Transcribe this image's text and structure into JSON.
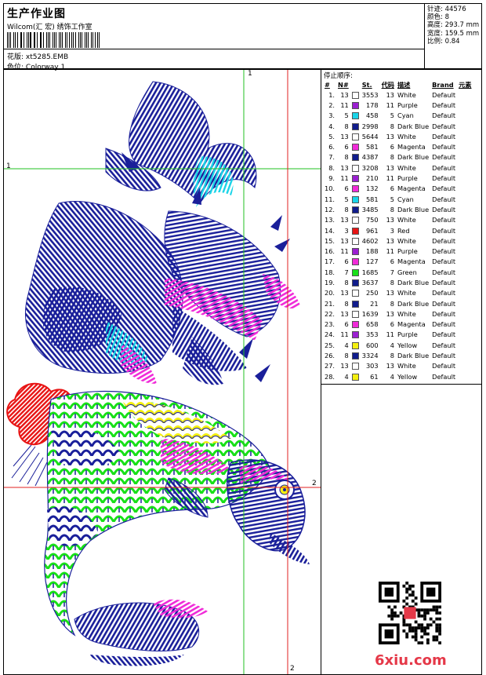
{
  "header": {
    "title": "生产作业图",
    "subtitle": "Wilcom(汇 宏) 绣饰工作室",
    "design_label": "花版:",
    "design_value": "xt5285.EMB",
    "colorway_label": "色位:",
    "colorway_value": "Colorway 1"
  },
  "stats": [
    {
      "label": "针迹:",
      "value": "44576"
    },
    {
      "label": "颜色:",
      "value": "8"
    },
    {
      "label": "高度:",
      "value": "293.7 mm"
    },
    {
      "label": "宽度:",
      "value": "159.5 mm"
    },
    {
      "label": "比例:",
      "value": "0.84"
    }
  ],
  "stop_sequence": {
    "title": "停止顺序:",
    "headers": [
      "#",
      "N#",
      "St.",
      "代码",
      "描述",
      "Brand",
      "元素"
    ],
    "rows": [
      {
        "idx": "1.",
        "n": "13",
        "color": "#ffffff",
        "st": "3553",
        "code": "13",
        "desc": "White",
        "brand": "Default"
      },
      {
        "idx": "2.",
        "n": "11",
        "color": "#9b1fd1",
        "st": "178",
        "code": "11",
        "desc": "Purple",
        "brand": "Default"
      },
      {
        "idx": "3.",
        "n": "5",
        "color": "#1ad4e8",
        "st": "458",
        "code": "5",
        "desc": "Cyan",
        "brand": "Default"
      },
      {
        "idx": "4.",
        "n": "8",
        "color": "#101c8c",
        "st": "2998",
        "code": "8",
        "desc": "Dark Blue",
        "brand": "Default"
      },
      {
        "idx": "5.",
        "n": "13",
        "color": "#ffffff",
        "st": "5644",
        "code": "13",
        "desc": "White",
        "brand": "Default"
      },
      {
        "idx": "6.",
        "n": "6",
        "color": "#f02ad8",
        "st": "581",
        "code": "6",
        "desc": "Magenta",
        "brand": "Default"
      },
      {
        "idx": "7.",
        "n": "8",
        "color": "#101c8c",
        "st": "4387",
        "code": "8",
        "desc": "Dark Blue",
        "brand": "Default"
      },
      {
        "idx": "8.",
        "n": "13",
        "color": "#ffffff",
        "st": "3208",
        "code": "13",
        "desc": "White",
        "brand": "Default"
      },
      {
        "idx": "9.",
        "n": "11",
        "color": "#9b1fd1",
        "st": "210",
        "code": "11",
        "desc": "Purple",
        "brand": "Default"
      },
      {
        "idx": "10.",
        "n": "6",
        "color": "#f02ad8",
        "st": "132",
        "code": "6",
        "desc": "Magenta",
        "brand": "Default"
      },
      {
        "idx": "11.",
        "n": "5",
        "color": "#1ad4e8",
        "st": "581",
        "code": "5",
        "desc": "Cyan",
        "brand": "Default"
      },
      {
        "idx": "12.",
        "n": "8",
        "color": "#101c8c",
        "st": "3485",
        "code": "8",
        "desc": "Dark Blue",
        "brand": "Default"
      },
      {
        "idx": "13.",
        "n": "13",
        "color": "#ffffff",
        "st": "750",
        "code": "13",
        "desc": "White",
        "brand": "Default"
      },
      {
        "idx": "14.",
        "n": "3",
        "color": "#e81414",
        "st": "961",
        "code": "3",
        "desc": "Red",
        "brand": "Default"
      },
      {
        "idx": "15.",
        "n": "13",
        "color": "#ffffff",
        "st": "4602",
        "code": "13",
        "desc": "White",
        "brand": "Default"
      },
      {
        "idx": "16.",
        "n": "11",
        "color": "#9b1fd1",
        "st": "188",
        "code": "11",
        "desc": "Purple",
        "brand": "Default"
      },
      {
        "idx": "17.",
        "n": "6",
        "color": "#f02ad8",
        "st": "127",
        "code": "6",
        "desc": "Magenta",
        "brand": "Default"
      },
      {
        "idx": "18.",
        "n": "7",
        "color": "#18e018",
        "st": "1685",
        "code": "7",
        "desc": "Green",
        "brand": "Default"
      },
      {
        "idx": "19.",
        "n": "8",
        "color": "#101c8c",
        "st": "3637",
        "code": "8",
        "desc": "Dark Blue",
        "brand": "Default"
      },
      {
        "idx": "20.",
        "n": "13",
        "color": "#ffffff",
        "st": "250",
        "code": "13",
        "desc": "White",
        "brand": "Default"
      },
      {
        "idx": "21.",
        "n": "8",
        "color": "#101c8c",
        "st": "21",
        "code": "8",
        "desc": "Dark Blue",
        "brand": "Default"
      },
      {
        "idx": "22.",
        "n": "13",
        "color": "#ffffff",
        "st": "1639",
        "code": "13",
        "desc": "White",
        "brand": "Default"
      },
      {
        "idx": "23.",
        "n": "6",
        "color": "#f02ad8",
        "st": "658",
        "code": "6",
        "desc": "Magenta",
        "brand": "Default"
      },
      {
        "idx": "24.",
        "n": "11",
        "color": "#9b1fd1",
        "st": "353",
        "code": "11",
        "desc": "Purple",
        "brand": "Default"
      },
      {
        "idx": "25.",
        "n": "4",
        "color": "#f4f010",
        "st": "600",
        "code": "4",
        "desc": "Yellow",
        "brand": "Default"
      },
      {
        "idx": "26.",
        "n": "8",
        "color": "#101c8c",
        "st": "3324",
        "code": "8",
        "desc": "Dark Blue",
        "brand": "Default"
      },
      {
        "idx": "27.",
        "n": "13",
        "color": "#ffffff",
        "st": "303",
        "code": "13",
        "desc": "White",
        "brand": "Default"
      },
      {
        "idx": "28.",
        "n": "4",
        "color": "#f4f010",
        "st": "61",
        "code": "4",
        "desc": "Yellow",
        "brand": "Default"
      }
    ]
  },
  "guides": {
    "v1": "1",
    "h1": "1",
    "h2": "2",
    "v2": "2"
  },
  "watermark": "6xiu.com",
  "colors": {
    "thread_blue": "#1a1f9a",
    "thread_cyan": "#1ad4e8",
    "thread_magenta": "#f02ad8",
    "thread_red": "#e81414",
    "thread_green": "#18e018",
    "thread_yellow": "#f4f010",
    "guide_green": "#22c022",
    "guide_red": "#e02020"
  }
}
